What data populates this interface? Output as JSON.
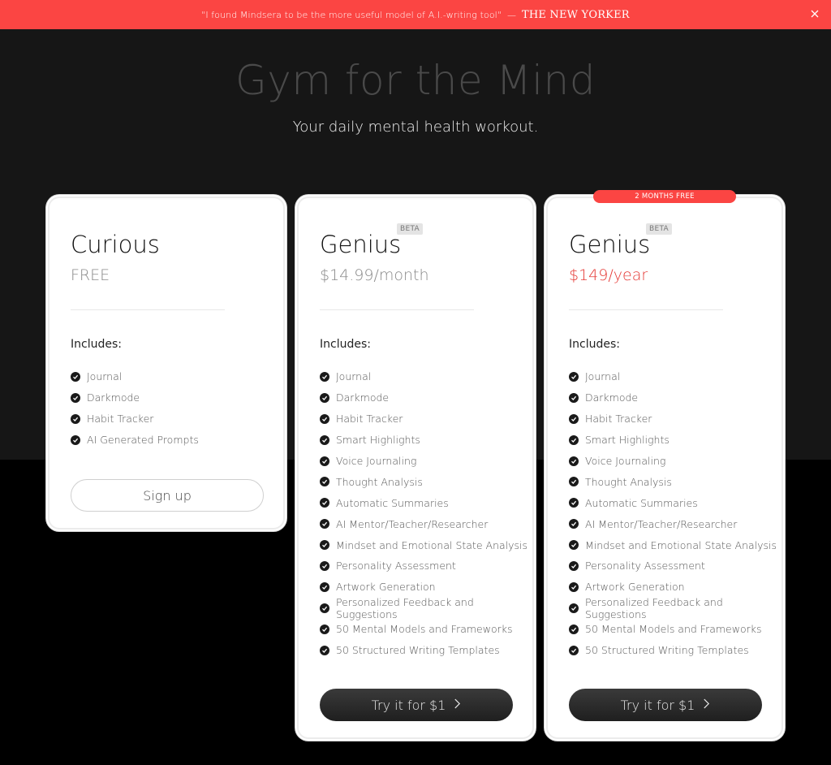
{
  "banner": {
    "quote": "\"I found Mindsera to be the more useful model of A.I.-writing tool\"",
    "dash": "—",
    "brand": "THE NEW YORKER"
  },
  "hero": {
    "title": "Gym for the Mind",
    "subtitle": "Your daily mental health workout."
  },
  "plans": [
    {
      "name": "Curious",
      "price": "FREE",
      "includes_label": "Includes:",
      "features": [
        "Journal",
        "Darkmode",
        "Habit Tracker",
        "AI Generated Prompts"
      ],
      "cta": "Sign up"
    },
    {
      "name": "Genius",
      "badge": "BETA",
      "price": "$14.99/month",
      "includes_label": "Includes:",
      "features": [
        "Journal",
        "Darkmode",
        "Habit Tracker",
        "Smart Highlights",
        "Voice Journaling",
        "Thought Analysis",
        "Automatic Summaries",
        "AI Mentor/Teacher/Researcher",
        "Mindset and Emotional State Analysis",
        "Personality Assessment",
        "Artwork Generation",
        "Personalized Feedback and Suggestions",
        "50 Mental Models and Frameworks",
        "50 Structured Writing Templates"
      ],
      "cta": "Try it for $1",
      "cta_icon": "chevron-right-icon"
    },
    {
      "name": "Genius",
      "badge": "BETA",
      "ribbon": "2 MONTHS FREE",
      "price": "$149/year",
      "price_color": "#e53935",
      "includes_label": "Includes:",
      "features": [
        "Journal",
        "Darkmode",
        "Habit Tracker",
        "Smart Highlights",
        "Voice Journaling",
        "Thought Analysis",
        "Automatic Summaries",
        "AI Mentor/Teacher/Researcher",
        "Mindset and Emotional State Analysis",
        "Personality Assessment",
        "Artwork Generation",
        "Personalized Feedback and Suggestions",
        "50 Mental Models and Frameworks",
        "50 Structured Writing Templates"
      ],
      "cta": "Try it for $1",
      "cta_icon": "chevron-right-icon"
    }
  ],
  "colors": {
    "accent": "#fb4543",
    "background_top": "#161616",
    "background_bottom": "#000000",
    "button_dark": "#2a2a2a"
  }
}
